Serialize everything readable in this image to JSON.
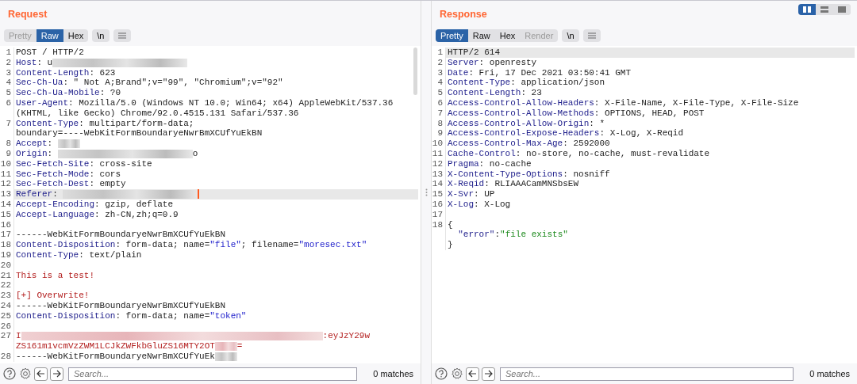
{
  "layout_toggle": [
    {
      "selected": true
    },
    {
      "selected": false
    },
    {
      "selected": false
    }
  ],
  "panes": [
    {
      "title": "Request",
      "view_tabs": [
        {
          "label": "Pretty",
          "selected": false,
          "disabled": true
        },
        {
          "label": "Raw",
          "selected": true,
          "disabled": false
        },
        {
          "label": "Hex",
          "selected": false,
          "disabled": false
        }
      ],
      "newline_button": "\\n",
      "lines": [
        {
          "number": "1",
          "highlighted": false,
          "parts": [
            {
              "kind": "plain",
              "text": "POST / HTTP/2"
            }
          ]
        },
        {
          "number": "2",
          "highlighted": false,
          "parts": [
            {
              "kind": "key",
              "text": "Host"
            },
            {
              "kind": "plain",
              "text": ": u"
            },
            {
              "kind": "redacted"
            }
          ]
        },
        {
          "number": "3",
          "highlighted": false,
          "parts": [
            {
              "kind": "key",
              "text": "Content-Length"
            },
            {
              "kind": "plain",
              "text": ": 623"
            }
          ]
        },
        {
          "number": "4",
          "highlighted": false,
          "parts": [
            {
              "kind": "key",
              "text": "Sec-Ch-Ua"
            },
            {
              "kind": "plain",
              "text": ": \" Not A;Brand\";v=\"99\", \"Chromium\";v=\"92\""
            }
          ]
        },
        {
          "number": "5",
          "highlighted": false,
          "parts": [
            {
              "kind": "key",
              "text": "Sec-Ch-Ua-Mobile"
            },
            {
              "kind": "plain",
              "text": ": ?0"
            }
          ]
        },
        {
          "number": "6",
          "highlighted": false,
          "parts": [
            {
              "kind": "key",
              "text": "User-Agent"
            },
            {
              "kind": "plain",
              "text": ": Mozilla/5.0 (Windows NT 10.0; Win64; x64) AppleWebKit/537.36"
            }
          ]
        },
        {
          "highlighted": false,
          "parts": [
            {
              "kind": "plain",
              "text": "(KHTML, like Gecko) Chrome/92.0.4515.131 Safari/537.36"
            }
          ]
        },
        {
          "number": "7",
          "highlighted": false,
          "parts": [
            {
              "kind": "key",
              "text": "Content-Type"
            },
            {
              "kind": "plain",
              "text": ": multipart/form-data;"
            }
          ]
        },
        {
          "highlighted": false,
          "parts": [
            {
              "kind": "plain",
              "text": "boundary=----WebKitFormBoundaryeNwrBmXCUfYuEkBN"
            }
          ]
        },
        {
          "number": "8",
          "highlighted": false,
          "parts": [
            {
              "kind": "key",
              "text": "Accept"
            },
            {
              "kind": "plain",
              "text": ": "
            },
            {
              "kind": "redacted-short"
            }
          ]
        },
        {
          "number": "9",
          "highlighted": false,
          "parts": [
            {
              "kind": "key",
              "text": "Origin"
            },
            {
              "kind": "plain",
              "text": ": "
            },
            {
              "kind": "redacted"
            },
            {
              "kind": "plain",
              "text": "o"
            }
          ]
        },
        {
          "number": "10",
          "highlighted": false,
          "parts": [
            {
              "kind": "key",
              "text": "Sec-Fetch-Site"
            },
            {
              "kind": "plain",
              "text": ": cross-site"
            }
          ]
        },
        {
          "number": "11",
          "highlighted": false,
          "parts": [
            {
              "kind": "key",
              "text": "Sec-Fetch-Mode"
            },
            {
              "kind": "plain",
              "text": ": cors"
            }
          ]
        },
        {
          "number": "12",
          "highlighted": false,
          "parts": [
            {
              "kind": "key",
              "text": "Sec-Fetch-Dest"
            },
            {
              "kind": "plain",
              "text": ": empty"
            }
          ]
        },
        {
          "number": "13",
          "highlighted": true,
          "parts": [
            {
              "kind": "key",
              "text": "Referer"
            },
            {
              "kind": "plain",
              "text": ": "
            },
            {
              "kind": "redacted"
            }
          ]
        },
        {
          "number": "14",
          "highlighted": false,
          "parts": [
            {
              "kind": "key",
              "text": "Accept-Encoding"
            },
            {
              "kind": "plain",
              "text": ": gzip, deflate"
            }
          ]
        },
        {
          "number": "15",
          "highlighted": false,
          "parts": [
            {
              "kind": "key",
              "text": "Accept-Language"
            },
            {
              "kind": "plain",
              "text": ": zh-CN,zh;q=0.9"
            }
          ]
        },
        {
          "number": "16",
          "highlighted": false
        },
        {
          "number": "17",
          "highlighted": false,
          "parts": [
            {
              "kind": "plain",
              "text": "------WebKitFormBoundaryeNwrBmXCUfYuEkBN"
            }
          ]
        },
        {
          "number": "18",
          "highlighted": false,
          "parts": [
            {
              "kind": "key",
              "text": "Content-Disposition"
            },
            {
              "kind": "plain",
              "text": ": form-data; name="
            },
            {
              "kind": "string",
              "text": "\"file\""
            },
            {
              "kind": "plain",
              "text": "; filename="
            },
            {
              "kind": "string",
              "text": "\"moresec.txt\""
            }
          ]
        },
        {
          "number": "19",
          "highlighted": false,
          "parts": [
            {
              "kind": "key",
              "text": "Content-Type"
            },
            {
              "kind": "plain",
              "text": ": text/plain"
            }
          ]
        },
        {
          "number": "20",
          "highlighted": false
        },
        {
          "number": "21",
          "highlighted": false,
          "parts": [
            {
              "kind": "body",
              "text": "This is a test!"
            }
          ]
        },
        {
          "number": "22",
          "highlighted": false
        },
        {
          "number": "23",
          "highlighted": false,
          "parts": [
            {
              "kind": "body",
              "text": "[+] Overwrite!"
            }
          ]
        },
        {
          "number": "24",
          "highlighted": false,
          "parts": [
            {
              "kind": "plain",
              "text": "------WebKitFormBoundaryeNwrBmXCUfYuEkBN"
            }
          ]
        },
        {
          "number": "25",
          "highlighted": false,
          "parts": [
            {
              "kind": "key",
              "text": "Content-Disposition"
            },
            {
              "kind": "plain",
              "text": ": form-data; name="
            },
            {
              "kind": "string",
              "text": "\"token\""
            }
          ]
        },
        {
          "number": "26",
          "highlighted": false
        },
        {
          "number": "27",
          "highlighted": false,
          "parts": [
            {
              "kind": "body",
              "text": "I"
            },
            {
              "kind": "redacted-long"
            },
            {
              "kind": "body",
              "text": ":eyJzY29w"
            }
          ]
        },
        {
          "highlighted": false,
          "parts": [
            {
              "kind": "body",
              "text": "ZS161m1vcmVzZWM1LCJkZWFkbGluZS16MTY2OT"
            },
            {
              "kind": "redacted-short"
            },
            {
              "kind": "body",
              "text": "="
            }
          ]
        },
        {
          "number": "28",
          "highlighted": false,
          "parts": [
            {
              "kind": "plain",
              "text": "------WebKitFormBoundaryeNwrBmXCUfYuEk"
            },
            {
              "kind": "redacted-short"
            }
          ]
        }
      ],
      "search": {
        "placeholder": "Search..."
      },
      "matches": "0 matches"
    },
    {
      "title": "Response",
      "view_tabs": [
        {
          "label": "Pretty",
          "selected": true,
          "disabled": false
        },
        {
          "label": "Raw",
          "selected": false,
          "disabled": false
        },
        {
          "label": "Hex",
          "selected": false,
          "disabled": false
        },
        {
          "label": "Render",
          "selected": false,
          "disabled": true
        }
      ],
      "newline_button": "\\n",
      "lines": [
        {
          "number": "1",
          "highlighted": true,
          "parts": [
            {
              "kind": "plain",
              "text": "HTTP/2 614"
            }
          ]
        },
        {
          "number": "2",
          "highlighted": false,
          "parts": [
            {
              "kind": "key",
              "text": "Server"
            },
            {
              "kind": "plain",
              "text": ": openresty"
            }
          ]
        },
        {
          "number": "3",
          "highlighted": false,
          "parts": [
            {
              "kind": "key",
              "text": "Date"
            },
            {
              "kind": "plain",
              "text": ": Fri, 17 Dec 2021 03:50:41 GMT"
            }
          ]
        },
        {
          "number": "4",
          "highlighted": false,
          "parts": [
            {
              "kind": "key",
              "text": "Content-Type"
            },
            {
              "kind": "plain",
              "text": ": application/json"
            }
          ]
        },
        {
          "number": "5",
          "highlighted": false,
          "parts": [
            {
              "kind": "key",
              "text": "Content-Length"
            },
            {
              "kind": "plain",
              "text": ": 23"
            }
          ]
        },
        {
          "number": "6",
          "highlighted": false,
          "parts": [
            {
              "kind": "key",
              "text": "Access-Control-Allow-Headers"
            },
            {
              "kind": "plain",
              "text": ": X-File-Name, X-File-Type, X-File-Size"
            }
          ]
        },
        {
          "number": "7",
          "highlighted": false,
          "parts": [
            {
              "kind": "key",
              "text": "Access-Control-Allow-Methods"
            },
            {
              "kind": "plain",
              "text": ": OPTIONS, HEAD, POST"
            }
          ]
        },
        {
          "number": "8",
          "highlighted": false,
          "parts": [
            {
              "kind": "key",
              "text": "Access-Control-Allow-Origin"
            },
            {
              "kind": "plain",
              "text": ": *"
            }
          ]
        },
        {
          "number": "9",
          "highlighted": false,
          "parts": [
            {
              "kind": "key",
              "text": "Access-Control-Expose-Headers"
            },
            {
              "kind": "plain",
              "text": ": X-Log, X-Reqid"
            }
          ]
        },
        {
          "number": "10",
          "highlighted": false,
          "parts": [
            {
              "kind": "key",
              "text": "Access-Control-Max-Age"
            },
            {
              "kind": "plain",
              "text": ": 2592000"
            }
          ]
        },
        {
          "number": "11",
          "highlighted": false,
          "parts": [
            {
              "kind": "key",
              "text": "Cache-Control"
            },
            {
              "kind": "plain",
              "text": ": no-store, no-cache, must-revalidate"
            }
          ]
        },
        {
          "number": "12",
          "highlighted": false,
          "parts": [
            {
              "kind": "key",
              "text": "Pragma"
            },
            {
              "kind": "plain",
              "text": ": no-cache"
            }
          ]
        },
        {
          "number": "13",
          "highlighted": false,
          "parts": [
            {
              "kind": "key",
              "text": "X-Content-Type-Options"
            },
            {
              "kind": "plain",
              "text": ": nosniff"
            }
          ]
        },
        {
          "number": "14",
          "highlighted": false,
          "parts": [
            {
              "kind": "key",
              "text": "X-Reqid"
            },
            {
              "kind": "plain",
              "text": ": RLIAAACamMNSbsEW"
            }
          ]
        },
        {
          "number": "15",
          "highlighted": false,
          "parts": [
            {
              "kind": "key",
              "text": "X-Svr"
            },
            {
              "kind": "plain",
              "text": ": UP"
            }
          ]
        },
        {
          "number": "16",
          "highlighted": false,
          "parts": [
            {
              "kind": "key",
              "text": "X-Log"
            },
            {
              "kind": "plain",
              "text": ": X-Log"
            }
          ]
        },
        {
          "number": "17",
          "highlighted": false
        },
        {
          "number": "18",
          "highlighted": false,
          "parts": [
            {
              "kind": "plain",
              "text": "{"
            }
          ]
        },
        {
          "highlighted": false,
          "parts": [
            {
              "kind": "json-key",
              "text": "  \"error\""
            },
            {
              "kind": "plain",
              "text": ":"
            },
            {
              "kind": "json-string",
              "text": "\"file exists\""
            }
          ]
        },
        {
          "highlighted": false,
          "parts": [
            {
              "kind": "plain",
              "text": "}"
            }
          ]
        }
      ],
      "search": {
        "placeholder": "Search..."
      },
      "matches": "0 matches"
    }
  ]
}
